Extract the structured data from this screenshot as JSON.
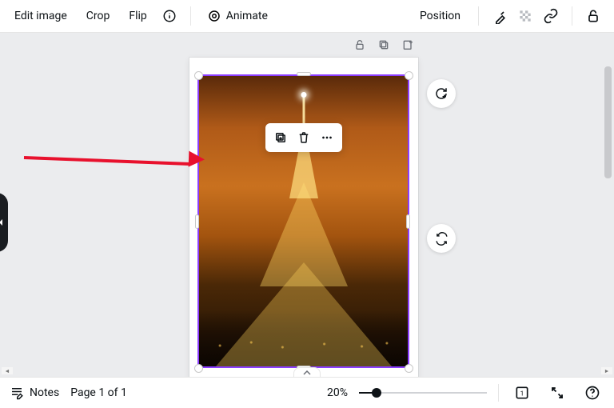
{
  "toolbar": {
    "edit_image": "Edit image",
    "crop": "Crop",
    "flip": "Flip",
    "animate": "Animate",
    "position": "Position"
  },
  "context_menu": {
    "duplicate": "Duplicate",
    "delete": "Delete",
    "more": "More"
  },
  "footer": {
    "notes": "Notes",
    "page_indicator": "Page 1 of 1",
    "zoom": "20%"
  },
  "image": {
    "subject": "Eiffel Tower at night"
  }
}
